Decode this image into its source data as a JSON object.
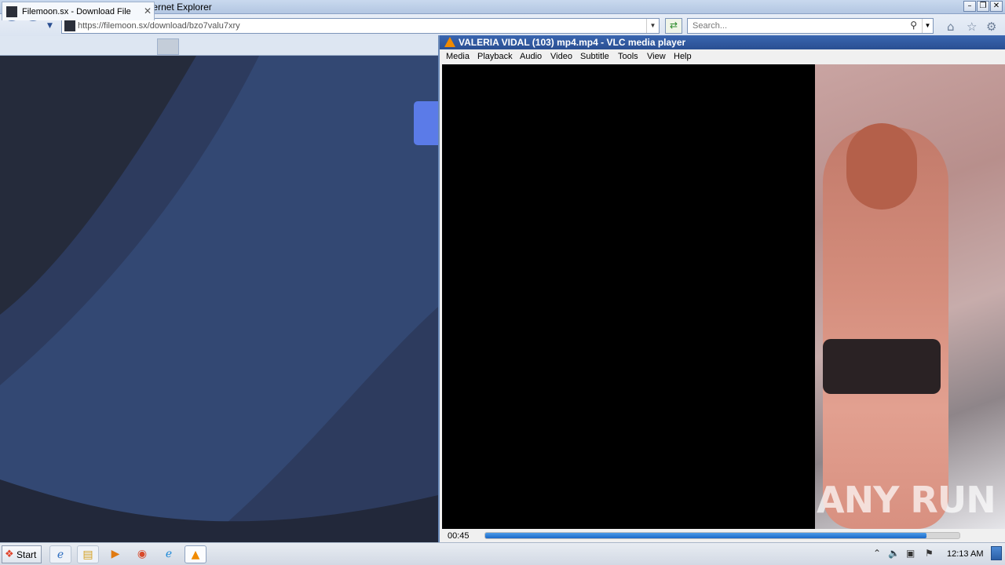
{
  "ie": {
    "title": "Filemoon.sx - Download File - Internet Explorer",
    "url": "https://filemoon.sx/download/bzo7valu7xry",
    "search_placeholder": "Search...",
    "tab_label": "Filemoon.sx - Download File"
  },
  "vlc": {
    "title": "VALERIA VIDAL (103) mp4.mp4 - VLC media player",
    "menu": [
      "Media",
      "Playback",
      "Audio",
      "Video",
      "Subtitle",
      "Tools",
      "View",
      "Help"
    ],
    "time": "00:45",
    "progress": 0.93,
    "watermark": "ANY RUN"
  },
  "taskbar": {
    "start_label": "Start",
    "clock": "12:13 AM"
  },
  "colors": {
    "page_bg": "#252b3b",
    "page_wave": "#2e4068",
    "accent_button": "#5b7be8",
    "vlc_progress": "#1a68c8"
  },
  "icons": [
    "ie-icon",
    "back-icon",
    "forward-icon",
    "refresh-icon",
    "search-icon",
    "home-icon",
    "favorites-star-icon",
    "settings-gear-icon",
    "vlc-cone-icon",
    "windows-logo-icon",
    "explorer-folder-icon",
    "media-player-icon",
    "chrome-icon",
    "edge-icon",
    "speaker-icon",
    "network-icon",
    "flag-icon"
  ]
}
